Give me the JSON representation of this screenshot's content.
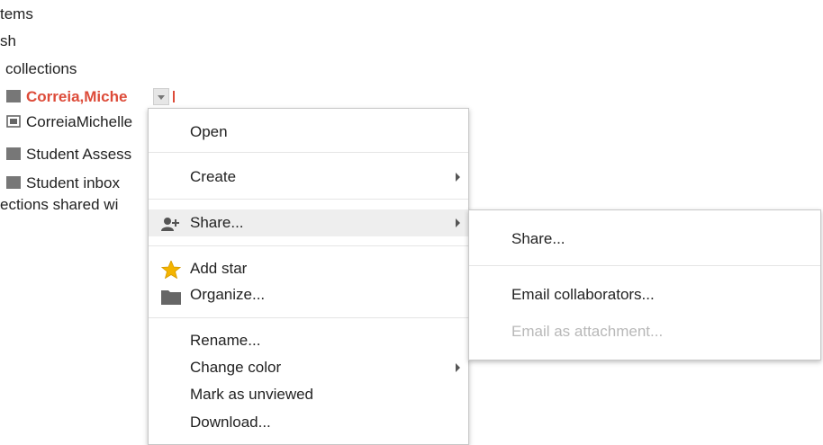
{
  "sidebar": {
    "items": [
      {
        "label": "tems",
        "icon": "none"
      },
      {
        "label": "sh",
        "icon": "none"
      },
      {
        "label": "collections",
        "icon": "none"
      },
      {
        "label": "Correia,Miche",
        "icon": "folder-icon",
        "active": true
      },
      {
        "label": "CorreiaMichelle",
        "icon": "shared-folder-icon"
      },
      {
        "label": "Student Assess",
        "icon": "folder-icon"
      },
      {
        "label": "Student inbox",
        "icon": "folder-icon"
      },
      {
        "label": "ections shared wi",
        "icon": "none"
      }
    ]
  },
  "context_menu": {
    "items": [
      {
        "label": "Open"
      },
      {
        "label": "Create",
        "has_submenu": true
      },
      {
        "label": "Share...",
        "has_submenu": true,
        "highlighted": true,
        "icon": "add-person-icon"
      },
      {
        "label": "Add star",
        "icon": "star-icon"
      },
      {
        "label": "Organize...",
        "icon": "folder-icon"
      },
      {
        "label": "Rename..."
      },
      {
        "label": "Change color",
        "has_submenu": true
      },
      {
        "label": "Mark as unviewed"
      },
      {
        "label": "Download..."
      }
    ]
  },
  "share_submenu": {
    "items": [
      {
        "label": "Share...",
        "enabled": true
      },
      {
        "label": "Email collaborators...",
        "enabled": true
      },
      {
        "label": "Email as attachment...",
        "enabled": false
      }
    ]
  },
  "colors": {
    "active_label": "#dd4b39",
    "highlight": "#eeeeee",
    "disabled_text": "#b8b8b8",
    "star": "#f4b400",
    "folder": "#777777"
  }
}
